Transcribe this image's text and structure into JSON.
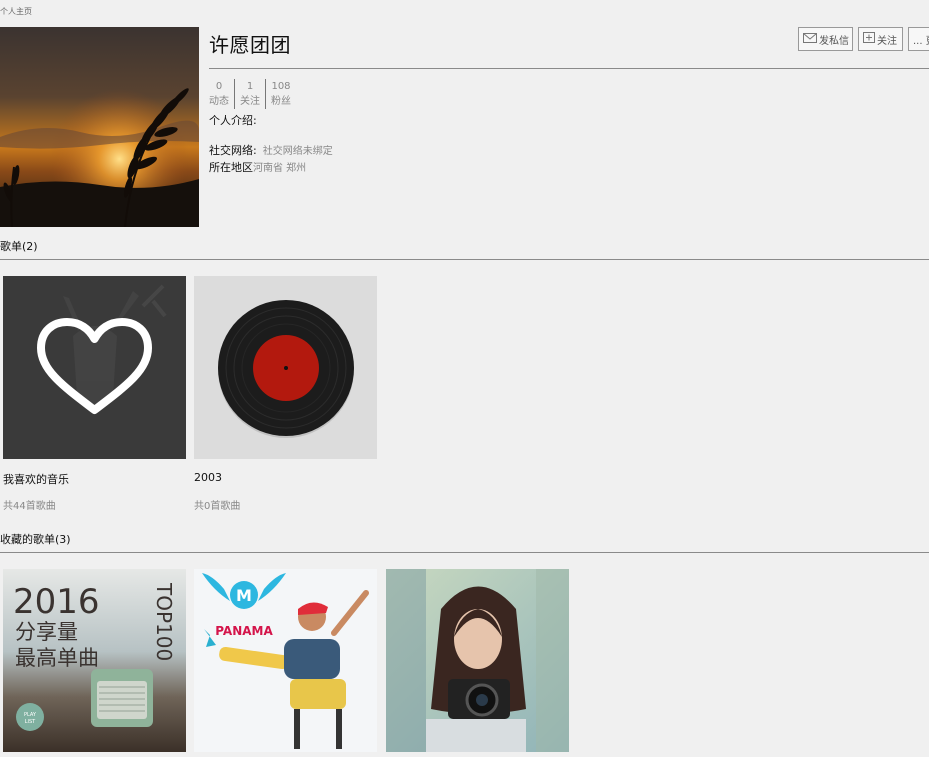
{
  "breadcrumb": "个人主页",
  "profile": {
    "username": "许愿团团",
    "stats": [
      {
        "count": "0",
        "label": "动态"
      },
      {
        "count": "1",
        "label": "关注"
      },
      {
        "count": "108",
        "label": "粉丝"
      }
    ],
    "intro_label": "个人介绍:",
    "social_label": "社交网络:",
    "social_value": "社交网络未绑定",
    "region_label": "所在地区",
    "region_value": "河南省 郑州"
  },
  "actions": {
    "message_label": "发私信",
    "follow_label": "关注",
    "more_label": "... 更"
  },
  "playlists": {
    "title": "歌单(2)",
    "items": [
      {
        "name": "我喜欢的音乐",
        "count": "共44首歌曲"
      },
      {
        "name": "2003",
        "count": "共0首歌曲"
      }
    ]
  },
  "favorites": {
    "title": "收藏的歌单(3)",
    "cover_texts": {
      "year": "2016",
      "line1": "分享量",
      "line2": "最高单曲",
      "top": "TOP100",
      "badge1": "PLAY",
      "badge2": "LIST",
      "brand": "PANAMA"
    }
  },
  "colors": {
    "background": "#f0f0f0",
    "divider": "#8a8a8a",
    "vinyl_label": "#b3190e"
  }
}
